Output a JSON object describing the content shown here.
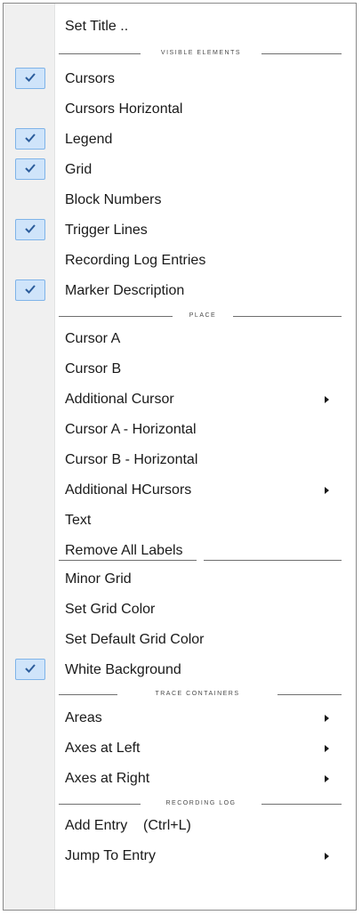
{
  "menu": {
    "set_title": "Set Title ..",
    "visible_elements": {
      "header": "VISIBLE ELEMENTS",
      "cursors": {
        "label": "Cursors",
        "checked": true
      },
      "cursors_horizontal": {
        "label": "Cursors Horizontal",
        "checked": false
      },
      "legend": {
        "label": "Legend",
        "checked": true
      },
      "grid": {
        "label": "Grid",
        "checked": true
      },
      "block_numbers": {
        "label": "Block Numbers",
        "checked": false
      },
      "trigger_lines": {
        "label": "Trigger Lines",
        "checked": true
      },
      "recording_log_entries": {
        "label": "Recording Log Entries",
        "checked": false
      },
      "marker_description": {
        "label": "Marker Description",
        "checked": true
      }
    },
    "place": {
      "header": "PLACE",
      "cursor_a": "Cursor A",
      "cursor_b": "Cursor B",
      "additional_cursor": "Additional Cursor",
      "cursor_a_horizontal": "Cursor A - Horizontal",
      "cursor_b_horizontal": "Cursor B - Horizontal",
      "additional_hcursors": "Additional HCursors",
      "text": "Text",
      "remove_all_labels": "Remove All Labels"
    },
    "grid_options": {
      "minor_grid": "Minor Grid",
      "set_grid_color": "Set Grid Color",
      "set_default_grid_color": "Set Default Grid Color",
      "white_background": {
        "label": "White Background",
        "checked": true
      }
    },
    "trace_containers": {
      "header": "TRACE CONTAINERS",
      "areas": "Areas",
      "axes_at_left": "Axes at Left",
      "axes_at_right": "Axes at Right"
    },
    "recording_log": {
      "header": "RECORDING LOG",
      "add_entry": "Add Entry    (Ctrl+L)",
      "jump_to_entry": "Jump To Entry"
    }
  },
  "colors": {
    "check_bg": "#cfe4fa",
    "check_border": "#7fb3e8",
    "check_mark": "#2c5d9c",
    "gutter": "#f0f0f0"
  }
}
